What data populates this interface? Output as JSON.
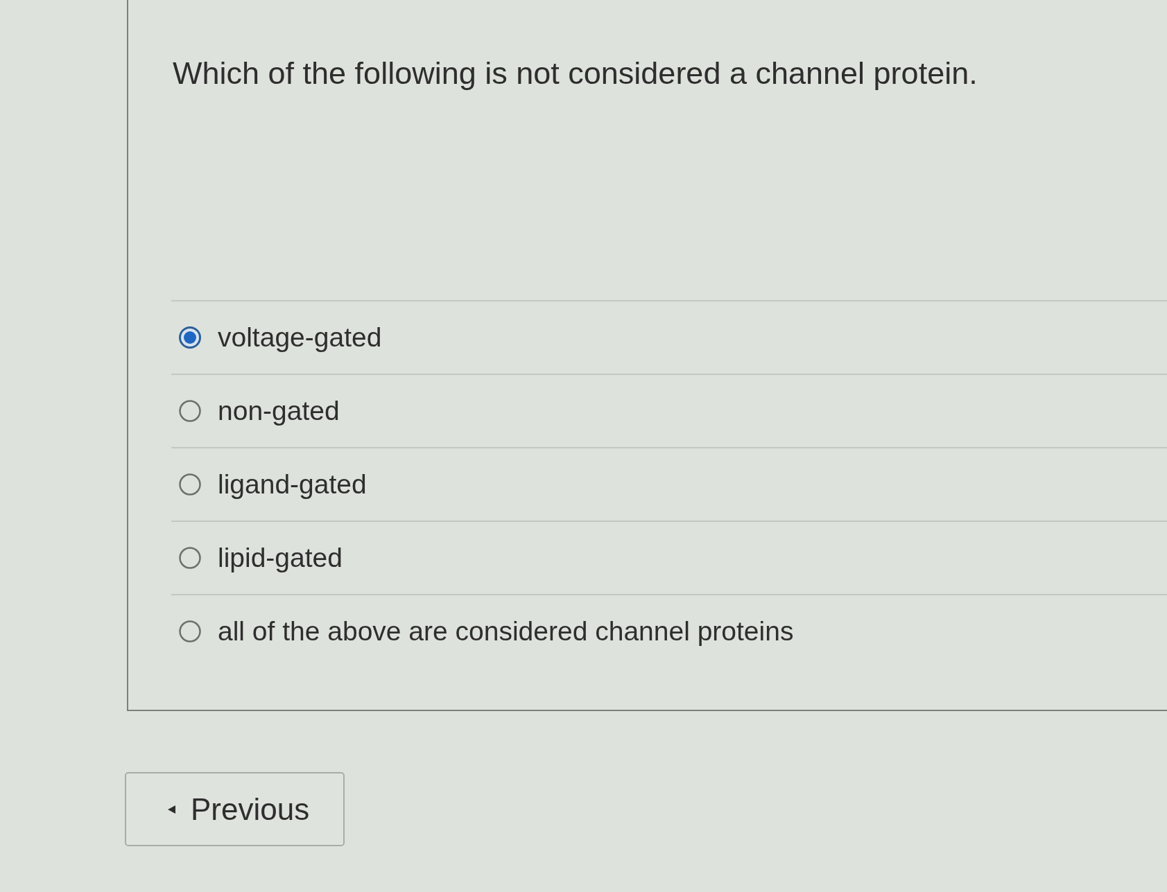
{
  "question": {
    "text": "Which of the following is not considered a channel protein."
  },
  "options": [
    {
      "label": "voltage-gated",
      "selected": true
    },
    {
      "label": "non-gated",
      "selected": false
    },
    {
      "label": "ligand-gated",
      "selected": false
    },
    {
      "label": "lipid-gated",
      "selected": false
    },
    {
      "label": "all of the above are considered channel proteins",
      "selected": false
    }
  ],
  "navigation": {
    "previous": {
      "label": "Previous"
    }
  }
}
